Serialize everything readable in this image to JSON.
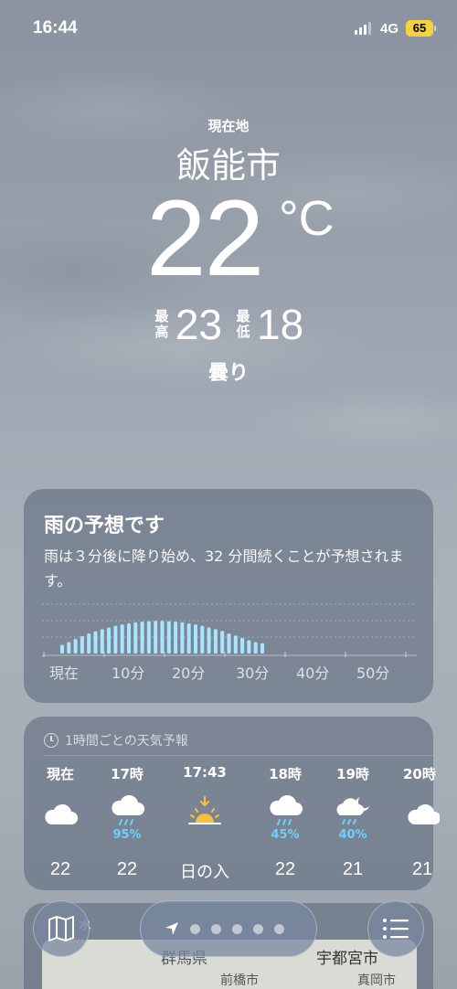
{
  "status_bar": {
    "time": "16:44",
    "network": "4G",
    "battery": "65",
    "battery_color": "#f6d33b"
  },
  "header": {
    "location_label": "現在地",
    "city": "飯能市",
    "temperature": "22",
    "unit": "°C",
    "high_label": "最高",
    "high": "23",
    "low_label": "最低",
    "low": "18",
    "condition": "曇り"
  },
  "rain_card": {
    "title": "雨の予想です",
    "description": "雨は３分後に降り始め、32 分間続くことが予想されます。",
    "axis_labels": [
      "現在",
      "10分",
      "20分",
      "30分",
      "40分",
      "50分"
    ],
    "bar_color": "#a8e6ff",
    "intensity": [
      0.25,
      0.33,
      0.42,
      0.5,
      0.58,
      0.64,
      0.7,
      0.75,
      0.8,
      0.84,
      0.87,
      0.9,
      0.92,
      0.93,
      0.94,
      0.94,
      0.93,
      0.92,
      0.9,
      0.87,
      0.84,
      0.8,
      0.75,
      0.7,
      0.65,
      0.58,
      0.52,
      0.45,
      0.38,
      0.33,
      0.3
    ]
  },
  "hourly": {
    "header": "1時間ごとの天気予報",
    "items": [
      {
        "time": "現在",
        "icon": "cloud-icon",
        "pct": "",
        "temp": "22"
      },
      {
        "time": "17時",
        "icon": "cloud-rain-icon",
        "pct": "95%",
        "temp": "22"
      },
      {
        "time": "17:43",
        "icon": "sunset-icon",
        "pct": "",
        "temp": "日の入"
      },
      {
        "time": "18時",
        "icon": "cloud-rain-icon",
        "pct": "45%",
        "temp": "22"
      },
      {
        "time": "19時",
        "icon": "cloud-moon-rain-icon",
        "pct": "40%",
        "temp": "21"
      },
      {
        "time": "20時",
        "icon": "cloud-icon",
        "pct": "",
        "temp": "21"
      }
    ],
    "precip_color": "#6fd0ff"
  },
  "map_card": {
    "header": "水",
    "labels": [
      "群馬県",
      "宇都宮市",
      "前橋市",
      "真岡市"
    ]
  }
}
